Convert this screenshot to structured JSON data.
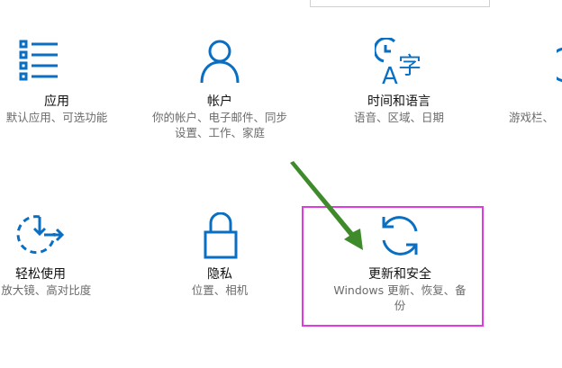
{
  "colors": {
    "icon_blue": "#0a6fc2",
    "highlight": "#e03be0",
    "arrow": "#3f8b2b"
  },
  "tiles": [
    {
      "icon": "list-icon",
      "title": "应用",
      "desc": "默认应用、可选功能"
    },
    {
      "icon": "person-icon",
      "title": "帐户",
      "desc_line1": "你的帐户、电子邮件、同步",
      "desc_line2": "设置、工作、家庭"
    },
    {
      "icon": "time-language-icon",
      "title": "时间和语言",
      "desc": "语音、区域、日期"
    },
    {
      "icon": "gaming-icon",
      "desc": "游戏栏、"
    },
    {
      "icon": "ease-of-access-icon",
      "title": "轻松使用",
      "desc": "、放大镜、高对比度"
    },
    {
      "icon": "lock-icon",
      "title": "隐私",
      "desc": "位置、相机"
    },
    {
      "icon": "update-sync-icon",
      "title": "更新和安全",
      "desc_line1": "Windows 更新、恢复、备",
      "desc_line2": "份"
    }
  ],
  "time_icon_glyphs": {
    "letter": "A",
    "char": "字"
  }
}
